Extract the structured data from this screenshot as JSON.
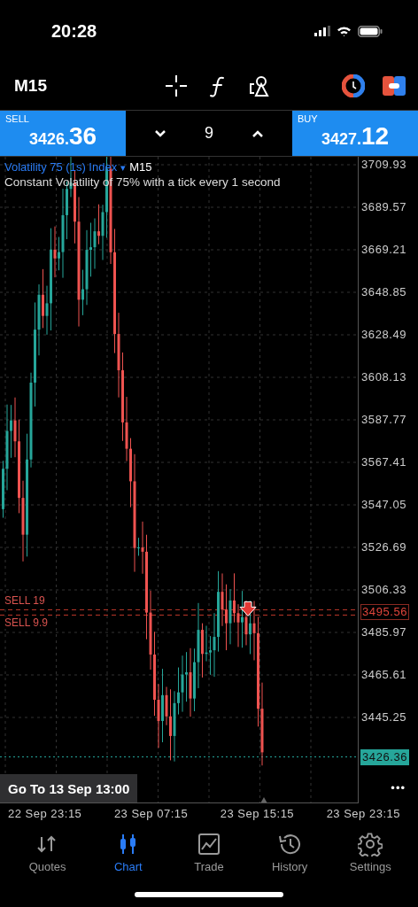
{
  "status_bar": {
    "time": "20:28"
  },
  "toolbar": {
    "timeframe": "M15"
  },
  "trade_panel": {
    "sell": {
      "label": "SELL",
      "price_head": "3426.",
      "price_tail": "36"
    },
    "volume": "9",
    "buy": {
      "label": "BUY",
      "price_head": "3427.",
      "price_tail": "12"
    }
  },
  "chart": {
    "symbol": "Volatility 75 (1s) Index",
    "symbol_caret": "▾",
    "timeframe": "M15",
    "description": "Constant Volatility of 75% with a tick every 1 second",
    "price_ticks": [
      "3709.93",
      "3689.57",
      "3669.21",
      "3648.85",
      "3628.49",
      "3608.13",
      "3587.77",
      "3567.41",
      "3547.05",
      "3526.69",
      "3506.33",
      "3485.97",
      "3465.61",
      "3445.25"
    ],
    "order": {
      "labels": [
        "SELL 19",
        "SELL 9.9"
      ],
      "price": "3495.56"
    },
    "current_price": "3426.36",
    "goto": "Go To 13 Sep 13:00",
    "more": "•••",
    "time_ticks": [
      "22 Sep 23:15",
      "23 Sep 07:15",
      "23 Sep 15:15",
      "23 Sep 23:15"
    ]
  },
  "tabs": [
    {
      "label": "Quotes",
      "selected": false
    },
    {
      "label": "Chart",
      "selected": true
    },
    {
      "label": "Trade",
      "selected": false
    },
    {
      "label": "History",
      "selected": false
    },
    {
      "label": "Settings",
      "selected": false
    }
  ]
}
